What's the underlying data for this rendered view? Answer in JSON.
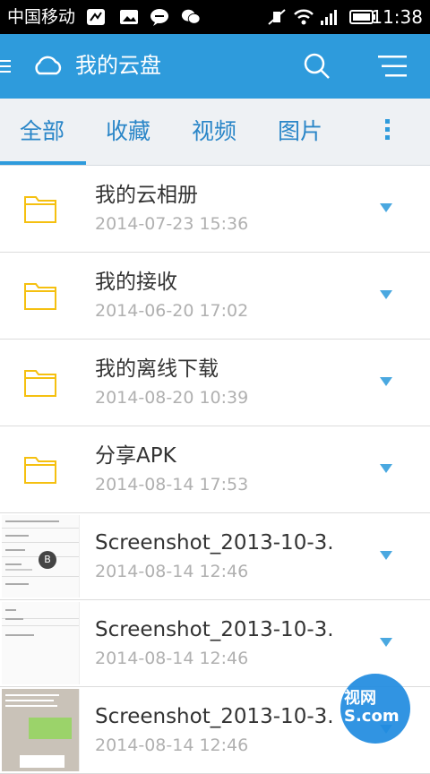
{
  "status_bar": {
    "carrier": "中国移动",
    "time": "11:38",
    "icons": [
      "sim-icon",
      "image-icon",
      "chat-icon",
      "wechat-icon",
      "mute-icon",
      "wifi-icon",
      "signal-icon",
      "battery-icon"
    ]
  },
  "header": {
    "title": "我的云盘",
    "icons": [
      "menu-icon",
      "cloud-icon",
      "search-icon",
      "list-menu-icon"
    ],
    "accent": "#2e9bdc"
  },
  "tabs": [
    {
      "label": "全部",
      "active": true
    },
    {
      "label": "收藏",
      "active": false
    },
    {
      "label": "视频",
      "active": false
    },
    {
      "label": "图片",
      "active": false
    }
  ],
  "files": [
    {
      "name": "我的云相册",
      "date": "2014-07-23 15:36",
      "type": "folder"
    },
    {
      "name": "我的接收",
      "date": "2014-06-20 17:02",
      "type": "folder"
    },
    {
      "name": "我的离线下载",
      "date": "2014-08-20 10:39",
      "type": "folder"
    },
    {
      "name": "分享APK",
      "date": "2014-08-14 17:53",
      "type": "folder"
    },
    {
      "name": "Screenshot_2013-10-3.",
      "date": "2014-08-14 12:46",
      "type": "image"
    },
    {
      "name": "Screenshot_2013-10-3.",
      "date": "2014-08-14 12:46",
      "type": "image"
    },
    {
      "name": "Screenshot_2013-10-3.",
      "date": "2014-08-14 12:46",
      "type": "image"
    }
  ],
  "watermark": {
    "text": "视网 S.com"
  }
}
